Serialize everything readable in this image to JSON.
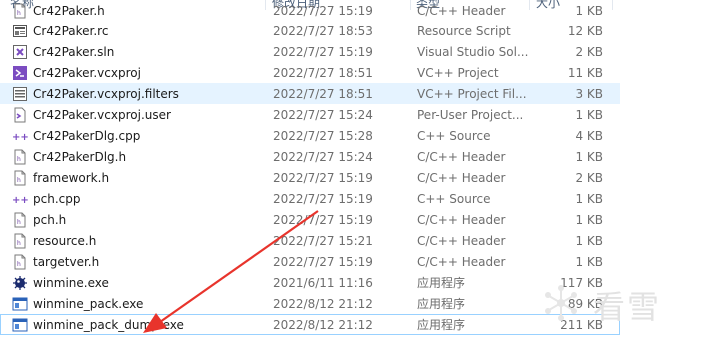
{
  "columns": {
    "name": "名称",
    "date": "修改日期",
    "type": "类型",
    "size": "大小"
  },
  "files": [
    {
      "name": "Cr42Paker.h",
      "date": "2022/7/27 15:19",
      "type": "C/C++ Header",
      "size": "1 KB",
      "icon": "c-header-file-icon"
    },
    {
      "name": "Cr42Paker.rc",
      "date": "2022/7/27 18:53",
      "type": "Resource Script",
      "size": "12 KB",
      "icon": "resource-script-icon"
    },
    {
      "name": "Cr42Paker.sln",
      "date": "2022/7/27 15:19",
      "type": "Visual Studio Sol...",
      "size": "2 KB",
      "icon": "visual-studio-solution-icon"
    },
    {
      "name": "Cr42Paker.vcxproj",
      "date": "2022/7/27 18:51",
      "type": "VC++ Project",
      "size": "11 KB",
      "icon": "vc-project-icon"
    },
    {
      "name": "Cr42Paker.vcxproj.filters",
      "date": "2022/7/27 18:51",
      "type": "VC++ Project Fil...",
      "size": "3 KB",
      "icon": "project-filters-icon"
    },
    {
      "name": "Cr42Paker.vcxproj.user",
      "date": "2022/7/27 15:24",
      "type": "Per-User Project...",
      "size": "1 KB",
      "icon": "project-user-icon"
    },
    {
      "name": "Cr42PakerDlg.cpp",
      "date": "2022/7/27 15:28",
      "type": "C++ Source",
      "size": "4 KB",
      "icon": "cpp-source-icon"
    },
    {
      "name": "Cr42PakerDlg.h",
      "date": "2022/7/27 15:24",
      "type": "C/C++ Header",
      "size": "1 KB",
      "icon": "c-header-file-icon"
    },
    {
      "name": "framework.h",
      "date": "2022/7/27 15:19",
      "type": "C/C++ Header",
      "size": "2 KB",
      "icon": "c-header-file-icon"
    },
    {
      "name": "pch.cpp",
      "date": "2022/7/27 15:19",
      "type": "C++ Source",
      "size": "1 KB",
      "icon": "cpp-source-icon"
    },
    {
      "name": "pch.h",
      "date": "2022/7/27 15:19",
      "type": "C/C++ Header",
      "size": "1 KB",
      "icon": "c-header-file-icon"
    },
    {
      "name": "resource.h",
      "date": "2022/7/27 15:21",
      "type": "C/C++ Header",
      "size": "1 KB",
      "icon": "c-header-file-icon"
    },
    {
      "name": "targetver.h",
      "date": "2022/7/27 15:19",
      "type": "C/C++ Header",
      "size": "1 KB",
      "icon": "c-header-file-icon"
    },
    {
      "name": "winmine.exe",
      "date": "2021/6/11 11:16",
      "type": "应用程序",
      "size": "117 KB",
      "icon": "minesweeper-app-icon"
    },
    {
      "name": "winmine_pack.exe",
      "date": "2022/8/12 21:12",
      "type": "应用程序",
      "size": "89 KB",
      "icon": "application-icon"
    },
    {
      "name": "winmine_pack_dump.exe",
      "date": "2022/8/12 21:12",
      "type": "应用程序",
      "size": "211 KB",
      "icon": "application-icon"
    }
  ],
  "watermark": {
    "text": "看雪",
    "color": "#e2e2e2"
  },
  "annotation": {
    "color": "#e8342c"
  },
  "colors": {
    "hover_bg": "#e5f3ff",
    "selected_border": "#99d1ff",
    "header_text": "#4c607a"
  }
}
